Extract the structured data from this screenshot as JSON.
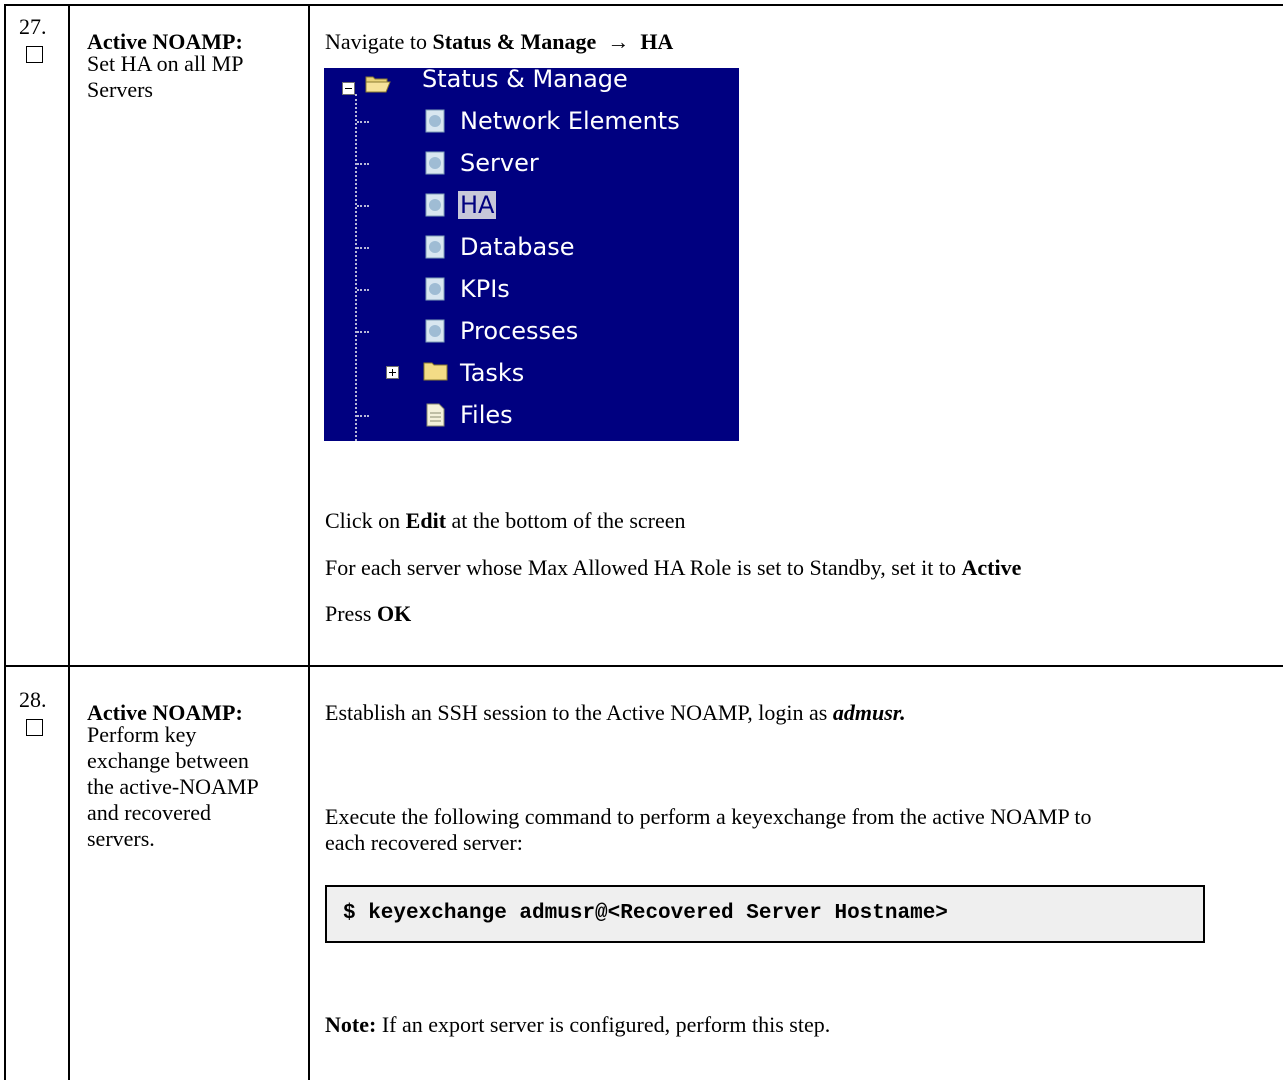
{
  "steps": [
    {
      "number": "27.",
      "title": "Active NOAMP:",
      "description_lines": [
        "Set HA on all MP",
        "Servers"
      ],
      "nav_prefix": "Navigate to ",
      "nav_path_1": "Status & Manage",
      "nav_arrow": "→",
      "nav_path_2": "HA",
      "tree": {
        "root": "Status & Manage",
        "items": [
          "Network Elements",
          "Server",
          "HA",
          "Database",
          "KPIs",
          "Processes"
        ],
        "folder_item": "Tasks",
        "file_item": "Files",
        "selected": "HA",
        "colors": {
          "background": "#000080",
          "text": "#ffffff",
          "highlight": "#c7c7d9"
        }
      },
      "instr1_prefix": "Click on ",
      "instr1_bold": "Edit",
      "instr1_suffix": " at the bottom of the screen",
      "instr2_prefix": "For each server whose Max Allowed HA Role is set to Standby, set it to ",
      "instr2_bold": "Active",
      "instr3_prefix": "Press ",
      "instr3_bold": "OK"
    },
    {
      "number": "28.",
      "title": "Active NOAMP:",
      "description_lines": [
        "Perform key",
        "exchange between",
        "the active-NOAMP",
        "and recovered",
        "servers."
      ],
      "ssh_prefix": "Establish an SSH session to the Active NOAMP, login as ",
      "ssh_user": "admusr.",
      "exec_line1": "Execute the following command to perform a keyexchange from the active NOAMP to",
      "exec_line2": "each recovered server:",
      "command": "$ keyexchange admusr@<Recovered Server Hostname>",
      "note_label": "Note:",
      "note_text": " If an export server is configured, perform this step."
    }
  ]
}
